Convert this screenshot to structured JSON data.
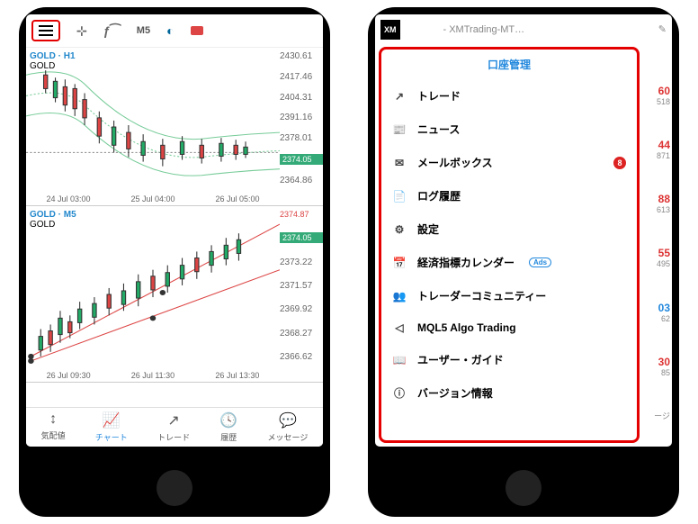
{
  "left": {
    "toolbar": {
      "timeframe": "M5"
    },
    "chart1": {
      "symbol_line1": "GOLD · H1",
      "symbol_line2": "GOLD",
      "y": [
        "2430.61",
        "2417.46",
        "2404.31",
        "2391.16",
        "2378.01",
        "2364.86"
      ],
      "price": "2374.05",
      "x": [
        "24 Jul 03:00",
        "25 Jul 04:00",
        "26 Jul 05:00"
      ]
    },
    "chart2": {
      "symbol_line1": "GOLD · M5",
      "symbol_line2": "GOLD",
      "y_top": "2374.87",
      "price": "2374.05",
      "y": [
        "2373.22",
        "2371.57",
        "2369.92",
        "2368.27",
        "2366.62"
      ],
      "x": [
        "26 Jul 09:30",
        "26 Jul 11:30",
        "26 Jul 13:30"
      ]
    },
    "tabs": {
      "t1": "気配値",
      "t2": "チャート",
      "t3": "トレード",
      "t4": "履歴",
      "t5": "メッセージ"
    }
  },
  "right": {
    "logo": "XM",
    "title": "- XMTrading-MT…",
    "account": "口座管理",
    "menu": [
      {
        "icon": "↗",
        "label": "トレード"
      },
      {
        "icon": "📰",
        "label": "ニュース"
      },
      {
        "icon": "✉",
        "label": "メールボックス",
        "badge": "8"
      },
      {
        "icon": "📄",
        "label": "ログ履歴"
      },
      {
        "icon": "⚙",
        "label": "設定"
      },
      {
        "icon": "📅",
        "label": "経済指標カレンダー",
        "ads": "Ads"
      },
      {
        "icon": "👥",
        "label": "トレーダーコミュニティー"
      },
      {
        "icon": "◁",
        "label": "MQL5 Algo Trading"
      },
      {
        "icon": "📖",
        "label": "ユーザー・ガイド"
      },
      {
        "icon": "ⓘ",
        "label": "バージョン情報"
      }
    ],
    "peek": [
      {
        "v": "60",
        "s": "518",
        "c": "r"
      },
      {
        "v": "44",
        "s": "871",
        "c": "r"
      },
      {
        "v": "88",
        "s": "613",
        "c": "r"
      },
      {
        "v": "55",
        "s": "495",
        "c": "r"
      },
      {
        "v": "03",
        "s": "62",
        "c": "b"
      },
      {
        "v": "30",
        "s": "85",
        "c": "r"
      }
    ],
    "peek_footer": "ージ"
  }
}
